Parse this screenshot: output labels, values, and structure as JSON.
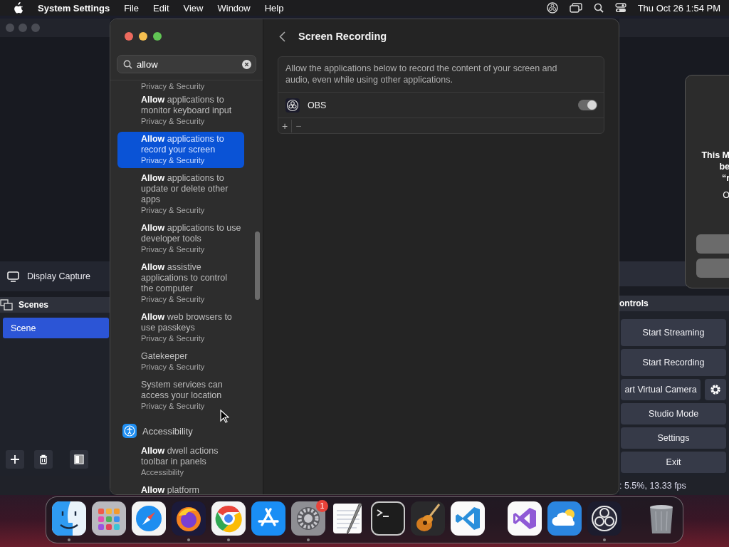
{
  "menu_bar": {
    "app_name": "System Settings",
    "menus": [
      "File",
      "Edit",
      "View",
      "Window",
      "Help"
    ],
    "clock": "Thu Oct 26  1:54 PM"
  },
  "obs": {
    "sources": [
      {
        "label": "Display Capture"
      }
    ],
    "scenes_title": "Scenes",
    "scenes": [
      {
        "label": "Scene",
        "selected": true
      }
    ],
    "controls_title": "ontrols",
    "controls": [
      {
        "label": "Start Streaming",
        "kind": "plain"
      },
      {
        "label": "Start Recording",
        "kind": "plain"
      },
      {
        "label": "art Virtual Camera",
        "kind": "split"
      },
      {
        "label": "Studio Mode",
        "kind": "plain"
      },
      {
        "label": "Settings",
        "kind": "plain"
      },
      {
        "label": "Exit",
        "kind": "plain"
      }
    ],
    "status": ": 5.5%, 13.33 fps",
    "dialog": {
      "lines": [
        {
          "text": "This M",
          "bold": true
        },
        {
          "text": "be",
          "bold": true
        },
        {
          "text": "“r",
          "bold": true
        },
        {
          "text": "O",
          "bold": false
        }
      ]
    }
  },
  "sidebar": {
    "search": {
      "value": "allow"
    },
    "results": [
      {
        "kind": "category",
        "subtitle": "Privacy & Security"
      },
      {
        "kind": "result",
        "title": "**Allow** applications to monitor keyboard input",
        "subtitle": "Privacy & Security",
        "selected": false
      },
      {
        "kind": "result",
        "title": "**Allow** applications to record your screen",
        "subtitle": "Privacy & Security",
        "selected": true
      },
      {
        "kind": "result",
        "title": "**Allow** applications to update or delete other apps",
        "subtitle": "Privacy & Security",
        "selected": false
      },
      {
        "kind": "result",
        "title": "**Allow** applications to use developer tools",
        "subtitle": "Privacy & Security",
        "selected": false
      },
      {
        "kind": "result",
        "title": "**Allow** assistive applications to control the computer",
        "subtitle": "Privacy & Security",
        "selected": false
      },
      {
        "kind": "result",
        "title": "**Allow** web browsers to use passkeys",
        "subtitle": "Privacy & Security",
        "selected": false
      },
      {
        "kind": "result",
        "title": "Gatekeeper",
        "subtitle": "Privacy & Security",
        "selected": false
      },
      {
        "kind": "result",
        "title": "System services can access your location",
        "subtitle": "Privacy & Security",
        "selected": false
      },
      {
        "kind": "section",
        "title": "Accessibility"
      },
      {
        "kind": "result",
        "title": "**Allow** dwell actions toolbar in panels",
        "subtitle": "Accessibility",
        "selected": false
      },
      {
        "kind": "result",
        "title": "**Allow** platform",
        "selected": false
      }
    ]
  },
  "pane": {
    "title": "Screen Recording",
    "description": "Allow the applications below to record the content of your screen and audio, even while using other applications.",
    "apps": [
      {
        "name": "OBS",
        "on": true
      }
    ],
    "footer_buttons": [
      "+",
      "−"
    ]
  },
  "dock": {
    "groups": [
      [
        {
          "running": true
        },
        {
          "running": false
        },
        {
          "running": false
        },
        {
          "running": true
        },
        {
          "running": true
        },
        {
          "running": false
        },
        {
          "running": true,
          "badge": "1"
        },
        {
          "running": false
        },
        {
          "running": false
        },
        {
          "running": false
        },
        {
          "running": false
        }
      ],
      [
        {
          "running": false
        },
        {
          "running": false
        },
        {
          "running": true
        }
      ],
      [
        {
          "running": false
        }
      ]
    ]
  }
}
